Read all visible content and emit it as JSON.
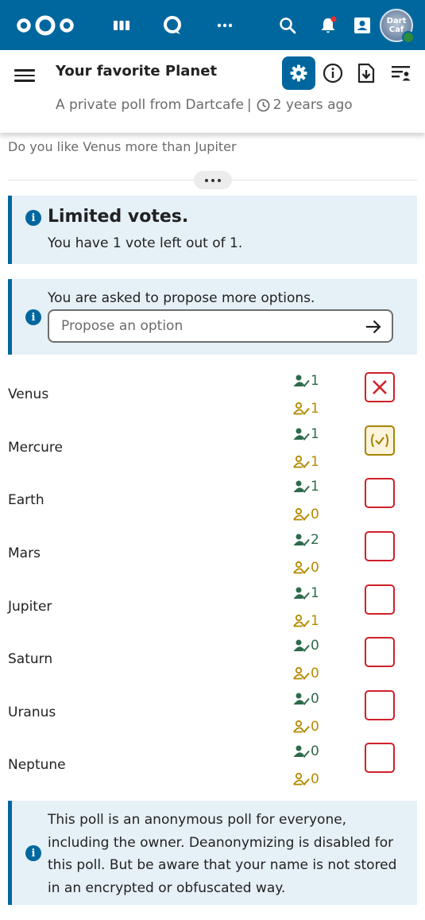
{
  "header": {
    "title": "Your favorite Planet",
    "access": "A private poll from Dartcafe",
    "separator": "|",
    "age": "2 years ago"
  },
  "avatar": {
    "text_line1": "Dart",
    "text_line2": "Caf"
  },
  "description": "Do you like Venus more than Jupiter",
  "limit_note": {
    "title": "Limited votes.",
    "body": "You have 1 vote left out of 1."
  },
  "propose": {
    "text": "You are asked to propose more options.",
    "placeholder": "Propose an option"
  },
  "options": [
    {
      "name": "Venus",
      "yes": "1",
      "maybe": "1",
      "vote": "no"
    },
    {
      "name": "Mercure",
      "yes": "1",
      "maybe": "1",
      "vote": "maybe"
    },
    {
      "name": "Earth",
      "yes": "1",
      "maybe": "0",
      "vote": "none"
    },
    {
      "name": "Mars",
      "yes": "2",
      "maybe": "0",
      "vote": "none"
    },
    {
      "name": "Jupiter",
      "yes": "1",
      "maybe": "1",
      "vote": "none"
    },
    {
      "name": "Saturn",
      "yes": "0",
      "maybe": "0",
      "vote": "none"
    },
    {
      "name": "Uranus",
      "yes": "0",
      "maybe": "0",
      "vote": "none"
    },
    {
      "name": "Neptune",
      "yes": "0",
      "maybe": "0",
      "vote": "none"
    }
  ],
  "anon_note": "This poll is an anonymous poll for everyone, including the owner. Deanonymizing is disabled for this poll. But be aware that your name is not stored in an encrypted or obfuscated way.",
  "colors": {
    "brand": "#00679e",
    "yes": "#2e6b4b",
    "maybe": "#b58a00",
    "no": "#d0202b",
    "note_bg": "#e6f0f7"
  }
}
